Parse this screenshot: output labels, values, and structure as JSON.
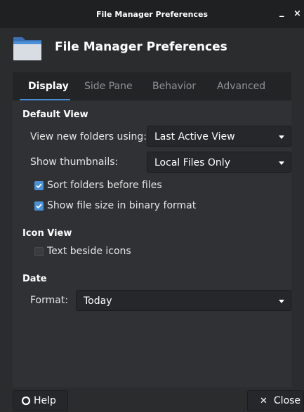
{
  "window": {
    "title": "File Manager Preferences",
    "minimize_glyph": "_",
    "close_glyph": "×"
  },
  "header": {
    "icon": "folder-icon",
    "title": "File Manager Preferences"
  },
  "tabs": [
    {
      "label": "Display",
      "active": true
    },
    {
      "label": "Side Pane",
      "active": false
    },
    {
      "label": "Behavior",
      "active": false
    },
    {
      "label": "Advanced",
      "active": false
    }
  ],
  "default_view": {
    "title": "Default View",
    "view_new_label": "View new folders using:",
    "view_new_value": "Last Active View",
    "thumbnails_label": "Show thumbnails:",
    "thumbnails_value": "Local Files Only",
    "sort_folders_label": "Sort folders before files",
    "sort_folders_checked": true,
    "binary_size_label": "Show file size in binary format",
    "binary_size_checked": true
  },
  "icon_view": {
    "title": "Icon View",
    "text_beside_label": "Text beside icons",
    "text_beside_checked": false
  },
  "date": {
    "title": "Date",
    "format_label": "Format:",
    "format_value": "Today"
  },
  "footer": {
    "help_label": "Help",
    "close_label": "Close"
  },
  "colors": {
    "accent": "#4a90d9",
    "background": "#2b2c2e",
    "panel": "#303134"
  }
}
